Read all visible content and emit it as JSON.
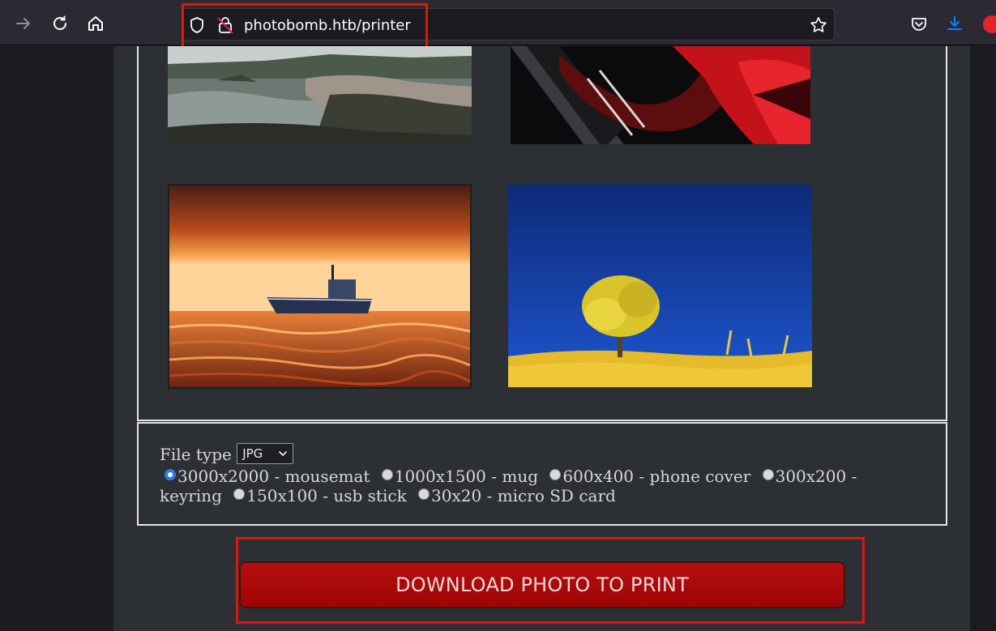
{
  "browser": {
    "url": "photobomb.htb/printer",
    "icons": [
      "forward-icon",
      "reload-icon",
      "home-icon",
      "shield-icon",
      "lock-icon",
      "bookmark-star-icon",
      "pocket-icon",
      "download-icon"
    ]
  },
  "form": {
    "file_type_label": "File type",
    "file_type_value": "JPG",
    "sizes": [
      "3000x2000 - mousemat",
      "1000x1500 - mug",
      "600x400 - phone cover",
      "300x200 - keyring",
      "150x100 - usb stick",
      "30x20 - micro SD card"
    ],
    "selected_size_index": 0
  },
  "download_button_label": "DOWNLOAD PHOTO TO PRINT",
  "colors": {
    "accent_red": "#a60808",
    "highlight_red": "#e0150f",
    "page_bg": "#2c2f33"
  }
}
